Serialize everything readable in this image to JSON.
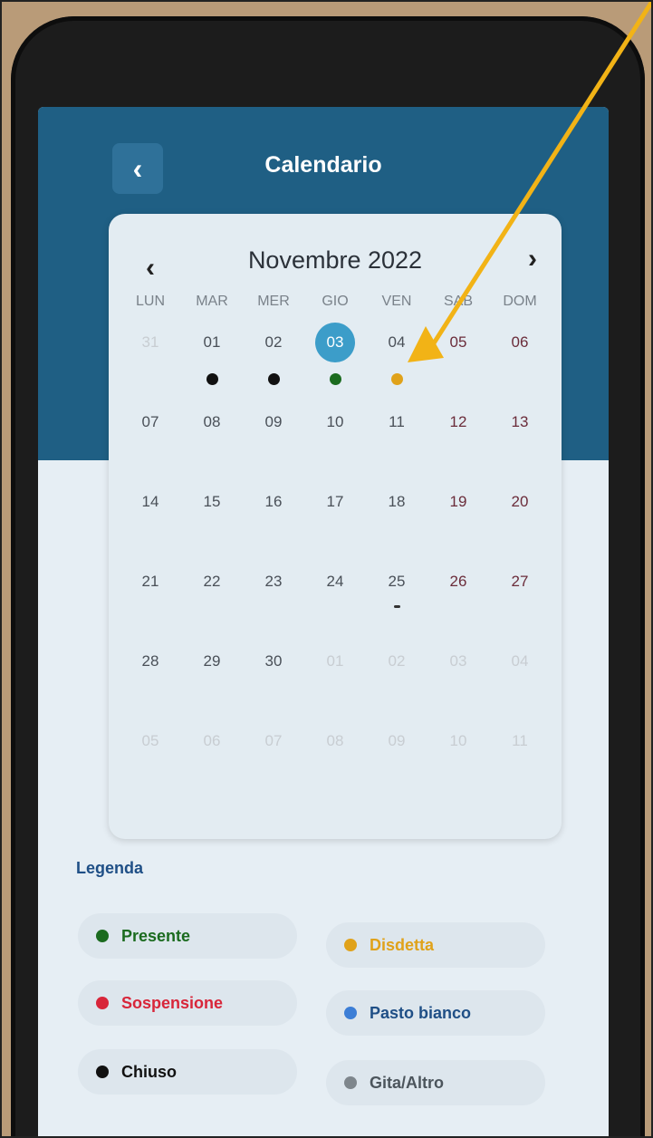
{
  "header": {
    "title": "Calendario",
    "back_icon": "chevron-left-icon"
  },
  "calendar": {
    "month_label": "Novembre 2022",
    "prev_icon": "chevron-left-icon",
    "next_icon": "chevron-right-icon",
    "weekdays": [
      "LUN",
      "MAR",
      "MER",
      "GIO",
      "VEN",
      "SAB",
      "DOM"
    ],
    "days": [
      {
        "d": "31",
        "muted": true
      },
      {
        "d": "01"
      },
      {
        "d": "02"
      },
      {
        "d": "03",
        "today": true
      },
      {
        "d": "04"
      },
      {
        "d": "05",
        "weekend": true
      },
      {
        "d": "06",
        "weekend": true
      },
      {
        "d": "07"
      },
      {
        "d": "08"
      },
      {
        "d": "09"
      },
      {
        "d": "10"
      },
      {
        "d": "11"
      },
      {
        "d": "12",
        "weekend": true
      },
      {
        "d": "13",
        "weekend": true
      },
      {
        "d": "14"
      },
      {
        "d": "15"
      },
      {
        "d": "16"
      },
      {
        "d": "17"
      },
      {
        "d": "18"
      },
      {
        "d": "19",
        "weekend": true
      },
      {
        "d": "20",
        "weekend": true
      },
      {
        "d": "21"
      },
      {
        "d": "22"
      },
      {
        "d": "23"
      },
      {
        "d": "24"
      },
      {
        "d": "25",
        "dash": true
      },
      {
        "d": "26",
        "weekend": true
      },
      {
        "d": "27",
        "weekend": true
      },
      {
        "d": "28"
      },
      {
        "d": "29"
      },
      {
        "d": "30"
      },
      {
        "d": "01",
        "muted": true
      },
      {
        "d": "02",
        "muted": true
      },
      {
        "d": "03",
        "muted": true
      },
      {
        "d": "04",
        "muted": true
      },
      {
        "d": "05",
        "muted": true
      },
      {
        "d": "06",
        "muted": true
      },
      {
        "d": "07",
        "muted": true
      },
      {
        "d": "08",
        "muted": true
      },
      {
        "d": "09",
        "muted": true
      },
      {
        "d": "10",
        "muted": true
      },
      {
        "d": "11",
        "muted": true
      }
    ],
    "events": [
      {
        "day_index": 1,
        "status": "chiuso"
      },
      {
        "day_index": 2,
        "status": "chiuso"
      },
      {
        "day_index": 3,
        "status": "presente"
      },
      {
        "day_index": 4,
        "status": "disdetta"
      }
    ]
  },
  "legend": {
    "title": "Legenda",
    "items": [
      {
        "key": "presente",
        "label": "Presente",
        "color": "#1b6b1f"
      },
      {
        "key": "disdetta",
        "label": "Disdetta",
        "color": "#e0a21a"
      },
      {
        "key": "sospensione",
        "label": "Sospensione",
        "color": "#d8263a"
      },
      {
        "key": "pasto_bianco",
        "label": "Pasto bianco",
        "color": "#3c7ed6"
      },
      {
        "key": "chiuso",
        "label": "Chiuso",
        "color": "#111111"
      },
      {
        "key": "gita_altro",
        "label": "Gita/Altro",
        "color": "#7e868c"
      }
    ]
  },
  "annotation": {
    "arrow_color": "#f2b316"
  }
}
